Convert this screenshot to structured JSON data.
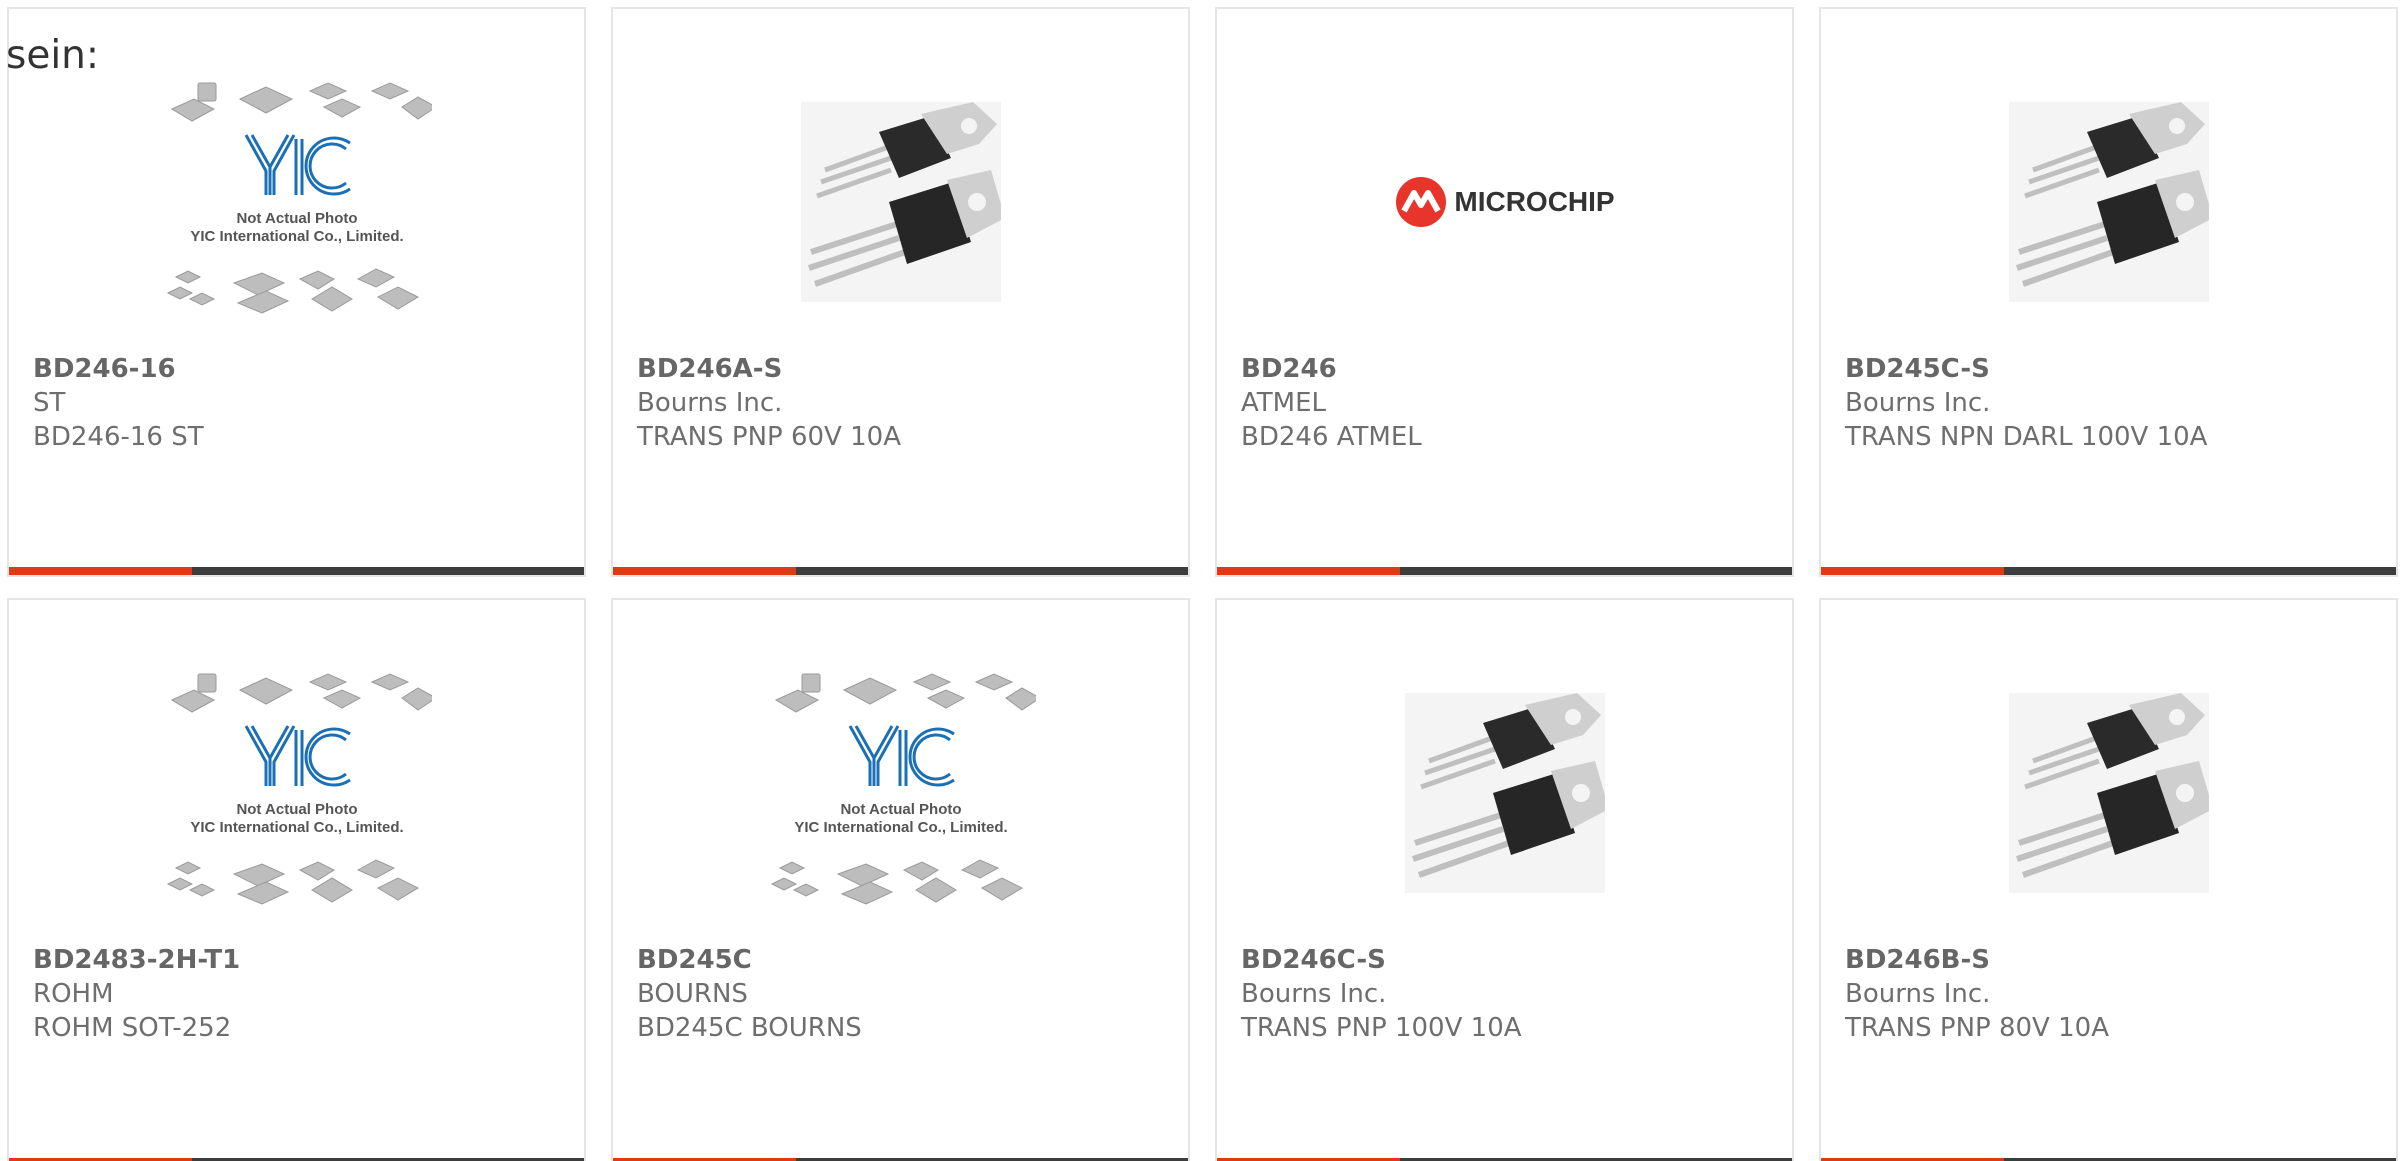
{
  "intro_text": "sein:",
  "products": [
    {
      "part_number": "BD246-16",
      "manufacturer": "ST",
      "description": "BD246-16 ST",
      "image": "placeholder-chips",
      "placeholder_line1": "Not Actual Photo",
      "placeholder_line2": "YIC International Co., Limited."
    },
    {
      "part_number": "BD246A-S",
      "manufacturer": "Bourns Inc.",
      "description": "TRANS PNP 60V 10A",
      "image": "to220-transistor"
    },
    {
      "part_number": "BD246",
      "manufacturer": "ATMEL",
      "description": "BD246 ATMEL",
      "image": "microchip-logo",
      "logo_text": "MICROCHIP"
    },
    {
      "part_number": "BD245C-S",
      "manufacturer": "Bourns Inc.",
      "description": "TRANS NPN DARL 100V 10A",
      "image": "to220-transistor"
    },
    {
      "part_number": "BD2483-2H-T1",
      "manufacturer": "ROHM",
      "description": "ROHM SOT-252",
      "image": "placeholder-chips",
      "placeholder_line1": "Not Actual Photo",
      "placeholder_line2": "YIC International Co., Limited."
    },
    {
      "part_number": "BD245C",
      "manufacturer": "BOURNS",
      "description": "BD245C BOURNS",
      "image": "placeholder-chips",
      "placeholder_line1": "Not Actual Photo",
      "placeholder_line2": "YIC International Co., Limited."
    },
    {
      "part_number": "BD246C-S",
      "manufacturer": "Bourns Inc.",
      "description": "TRANS PNP 100V 10A",
      "image": "to220-transistor"
    },
    {
      "part_number": "BD246B-S",
      "manufacturer": "Bourns Inc.",
      "description": "TRANS PNP 80V 10A",
      "image": "to220-transistor"
    }
  ],
  "colors": {
    "accent": "#e03a12",
    "bar": "#3d3d3d",
    "border": "#e5e5e5",
    "text": "#666666",
    "yic_blue": "#1a6fb5",
    "microchip_red": "#e8352b"
  }
}
